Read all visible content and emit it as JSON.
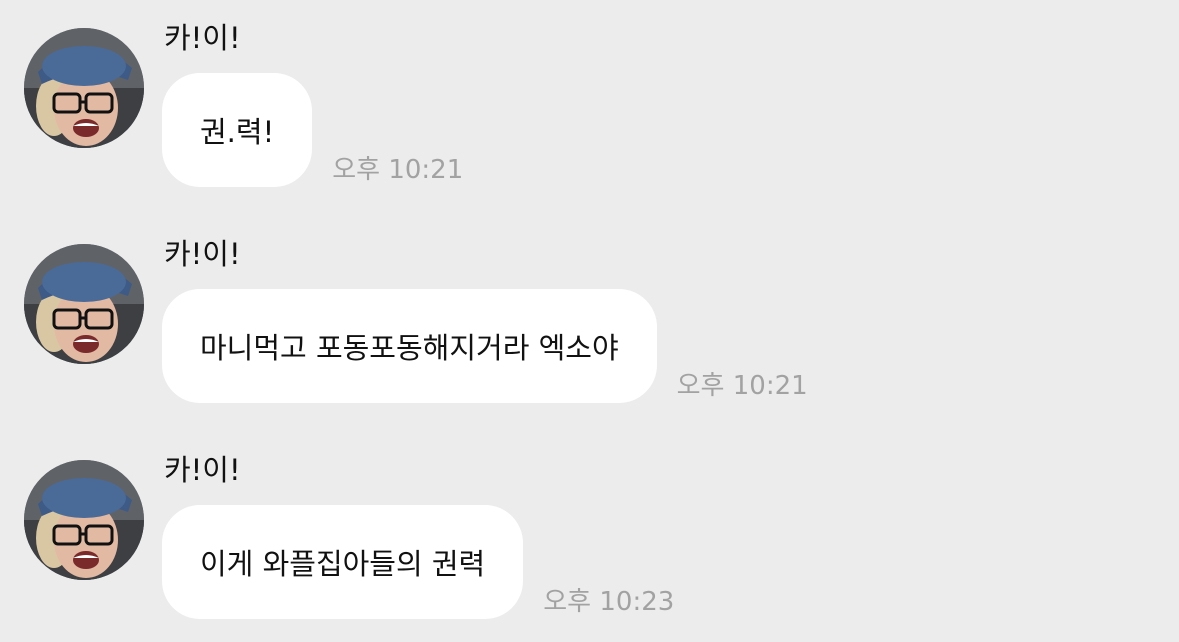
{
  "messages": [
    {
      "sender": "카!이!",
      "text": "권.력!",
      "time": "오후 10:21"
    },
    {
      "sender": "카!이!",
      "text": "마니먹고 포동포동해지거라 엑소야",
      "time": "오후 10:21"
    },
    {
      "sender": "카!이!",
      "text": "이게 와플집아들의 권력",
      "time": "오후 10:23"
    }
  ],
  "colors": {
    "background": "#ececec",
    "bubble": "#ffffff",
    "timestamp": "#a2a2a2",
    "text": "#111111"
  },
  "icons": {
    "avatar": "profile-photo"
  }
}
